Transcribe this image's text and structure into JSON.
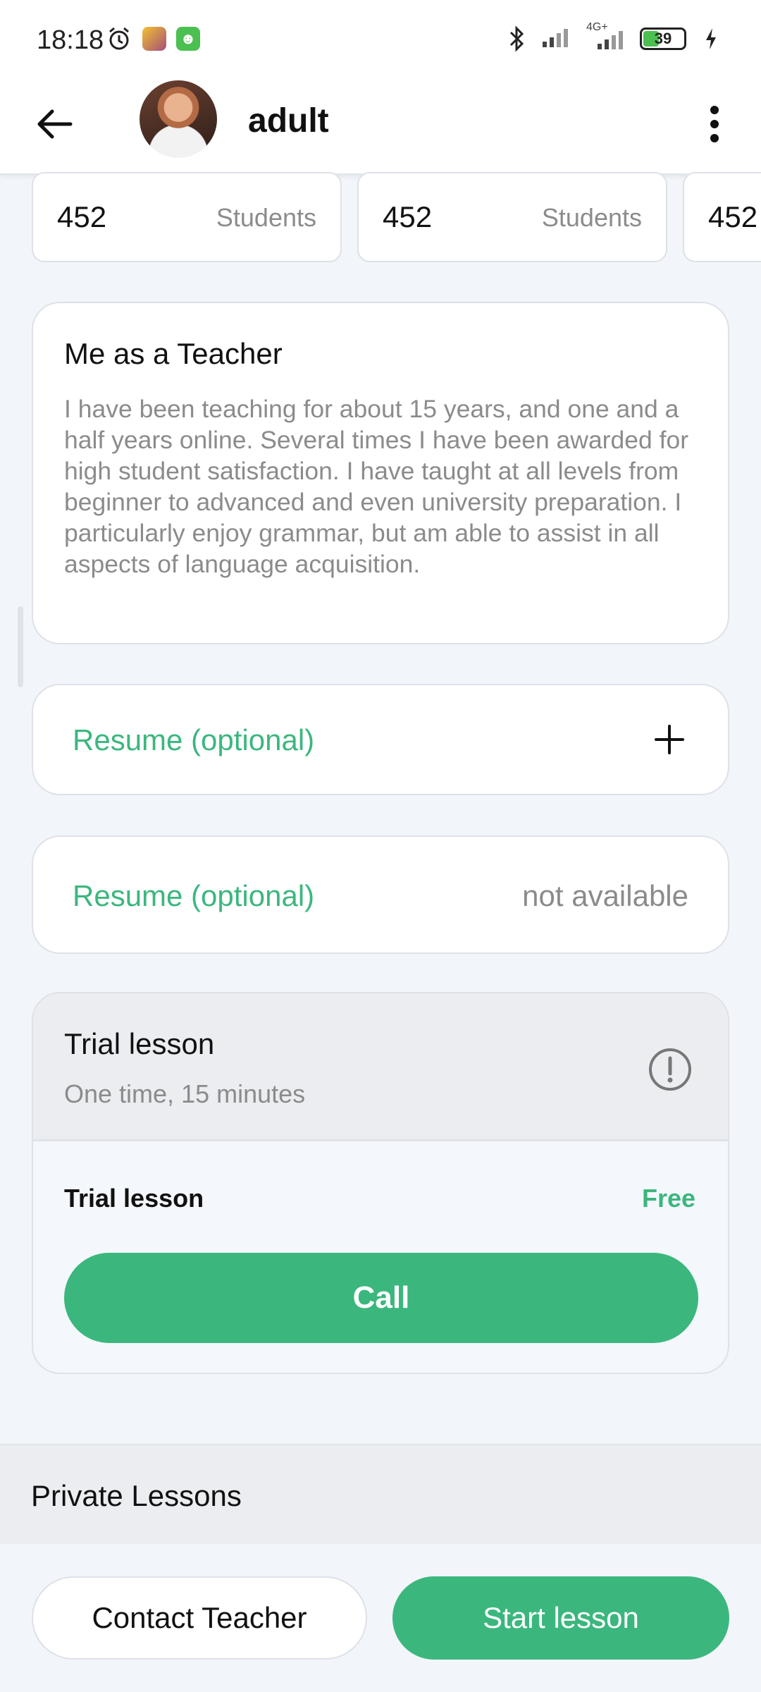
{
  "status_bar": {
    "time": "18:18",
    "network": "4G+",
    "battery": "39"
  },
  "header": {
    "title": "adult"
  },
  "stats": [
    {
      "value": "452",
      "label": "Students"
    },
    {
      "value": "452",
      "label": "Students"
    },
    {
      "value": "452",
      "label": ""
    }
  ],
  "about": {
    "title": "Me as a Teacher",
    "text": "I have been teaching for about 15 years, and one and a half years online. Several times I have been awarded for high student satisfaction. I have taught at all levels from beginner to advanced and even university preparation. I particularly enjoy grammar, but am able to assist in all aspects of language acquisition."
  },
  "resume_add": {
    "label": "Resume (optional)"
  },
  "resume_status": {
    "label": "Resume (optional)",
    "value": "not available"
  },
  "trial": {
    "title": "Trial lesson",
    "subtitle": "One time, 15 minutes",
    "row_label": "Trial lesson",
    "price": "Free",
    "call_label": "Call"
  },
  "private_lessons": {
    "title": "Private Lessons"
  },
  "actions": {
    "contact_label": "Contact Teacher",
    "start_label": "Start lesson"
  },
  "colors": {
    "accent": "#3bb77e",
    "background": "#f2f5fa",
    "muted_text": "#8b8b8b"
  }
}
